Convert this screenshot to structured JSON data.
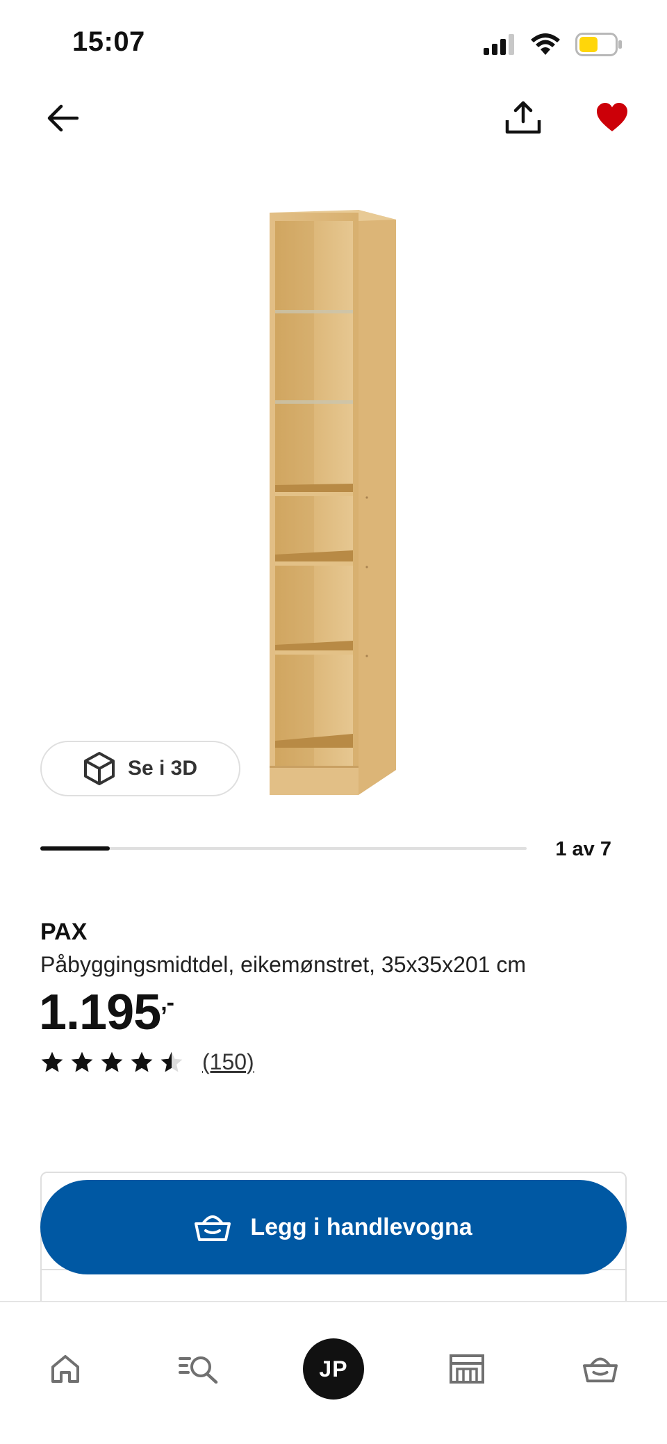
{
  "status_bar": {
    "time": "15:07",
    "icons": [
      "signal-icon",
      "wifi-icon",
      "battery-icon"
    ],
    "battery_color": "#ffd60a"
  },
  "top_nav": {
    "back_icon": "arrow-left-icon",
    "share_icon": "share-icon",
    "favorite_icon": "heart-filled-icon",
    "favorite_color": "#cc0008"
  },
  "gallery": {
    "view_3d_label": "Se i 3D",
    "position_label": "1 av 7",
    "current_index": 1,
    "total_images": 7
  },
  "product": {
    "brand": "PAX",
    "description": "Påbyggingsmidtdel, eikemønstret, 35x35x201 cm",
    "price_main": "1.195",
    "price_suffix": ",-",
    "rating_value": 4.5,
    "rating_max": 5,
    "rating_count": "(150)"
  },
  "cart_button": {
    "label": "Legg i handlevogna",
    "color": "#0058a3"
  },
  "tab_bar": {
    "items": [
      "home-icon",
      "search-list-icon",
      "profile-avatar",
      "store-icon",
      "basket-icon"
    ],
    "avatar_initials": "JP"
  }
}
